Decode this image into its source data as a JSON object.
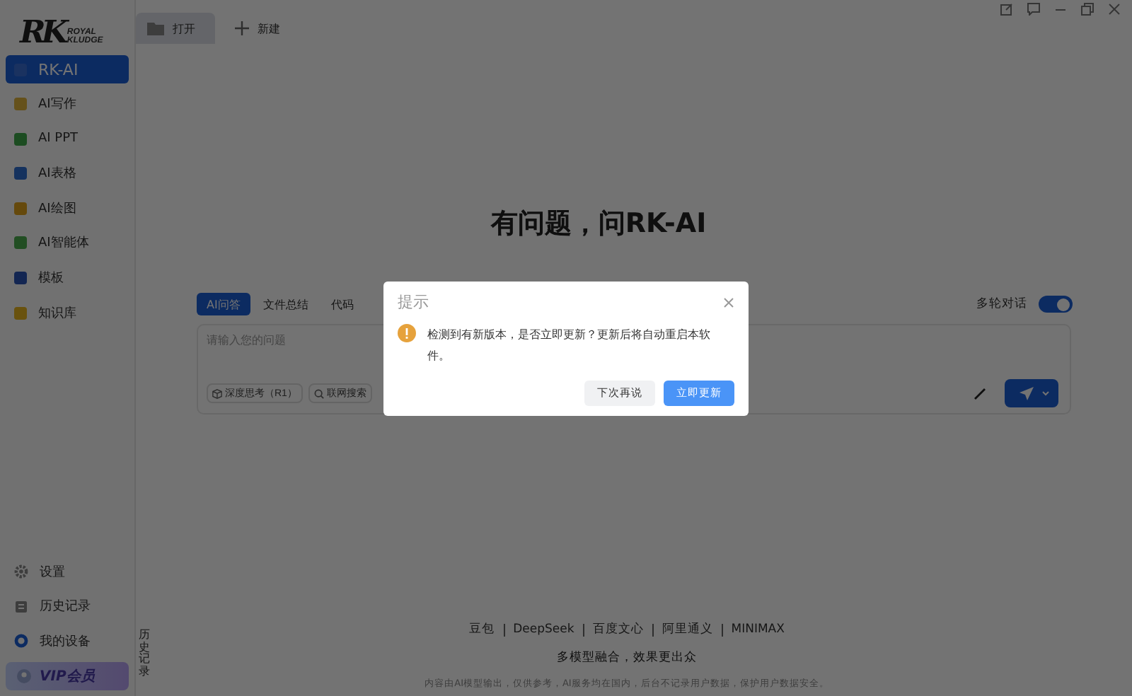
{
  "logo": {
    "mark": "RK",
    "line1": "ROYAL",
    "line2": "KLUDGE"
  },
  "sidebar": {
    "items": [
      {
        "label": "RK-AI",
        "selected": true
      },
      {
        "label": "AI写作",
        "selected": false
      },
      {
        "label": "AI PPT",
        "selected": false
      },
      {
        "label": "AI表格",
        "selected": false
      },
      {
        "label": "AI绘图",
        "selected": false
      },
      {
        "label": "AI智能体",
        "selected": false
      },
      {
        "label": "模板",
        "selected": false
      },
      {
        "label": "知识库",
        "selected": false
      }
    ],
    "bottom_items": [
      {
        "label": "设置",
        "kind": "gear"
      },
      {
        "label": "历史记录",
        "kind": "history"
      },
      {
        "label": "我的设备",
        "kind": "device"
      }
    ],
    "vip": "VIP会员"
  },
  "toolbar": {
    "tabs": [
      {
        "label": "打开",
        "selected": true
      },
      {
        "label": "新建",
        "selected": false
      }
    ]
  },
  "headline": "有问题，问RK-AI",
  "mode_tabs": [
    {
      "label": "AI问答",
      "selected": true
    },
    {
      "label": "文件总结",
      "selected": false
    },
    {
      "label": "代码",
      "selected": false
    }
  ],
  "multi_turn": {
    "label": "多轮对话",
    "on": true
  },
  "prompt": {
    "placeholder": "请输入您的问题",
    "chips": [
      {
        "label": "深度思考（R1）",
        "kind": "cube"
      },
      {
        "label": "联网搜索",
        "kind": "search"
      }
    ]
  },
  "history_tab": "历史记录",
  "models": [
    "豆包",
    "DeepSeek",
    "百度文心",
    "阿里通义",
    "MINIMAX"
  ],
  "slogan": "多模型融合，效果更出众",
  "disclaimer": "内容由AI模型输出，仅供参考，AI服务均在国内，后台不记录用户数据，保护用户数据安全。",
  "dialog": {
    "title": "提示",
    "message": "检测到有新版本，是否立即更新？更新后将自动重启本软件。",
    "buttons": [
      {
        "label": "下次再说",
        "kind": "secondary"
      },
      {
        "label": "立即更新",
        "kind": "primary"
      }
    ]
  }
}
